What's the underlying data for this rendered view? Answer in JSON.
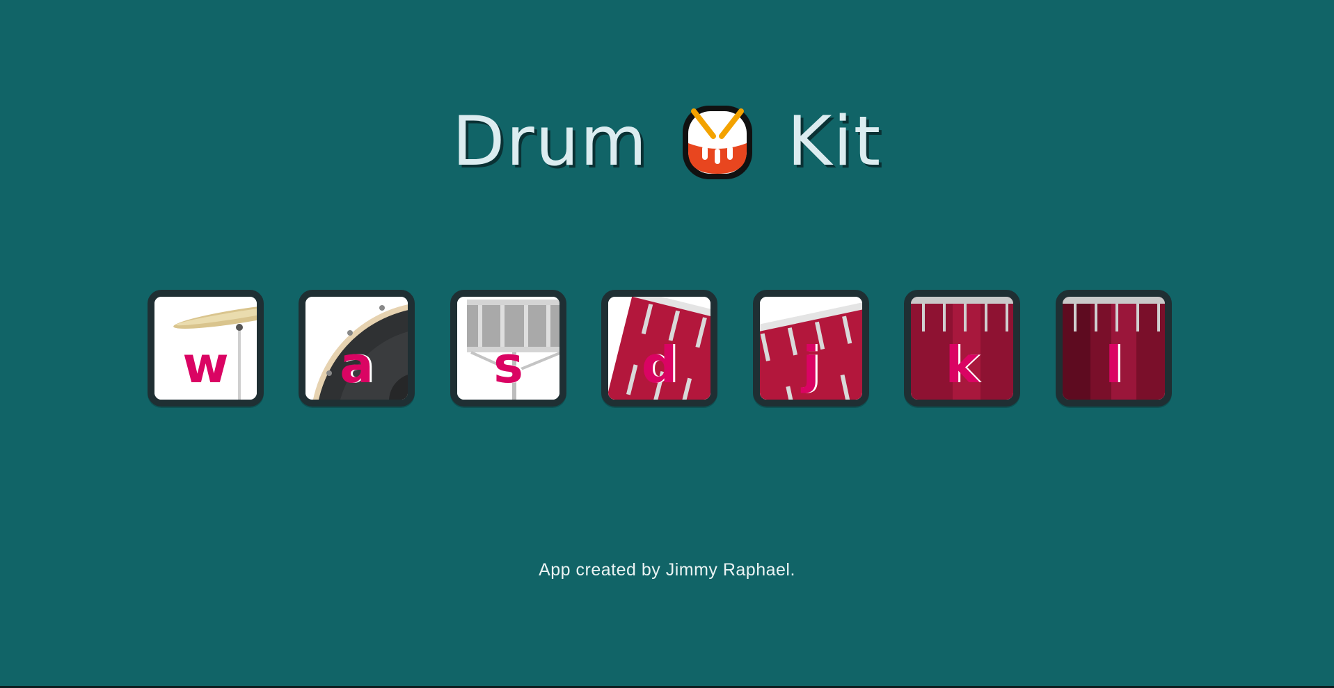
{
  "header": {
    "title_left": "Drum",
    "title_right": "Kit",
    "emoji_icon": "drum-emoji-icon"
  },
  "pads": [
    {
      "key": "w",
      "drum": "crash-cymbal"
    },
    {
      "key": "a",
      "drum": "kick-bass"
    },
    {
      "key": "s",
      "drum": "snare"
    },
    {
      "key": "d",
      "drum": "tom-1"
    },
    {
      "key": "j",
      "drum": "tom-2"
    },
    {
      "key": "k",
      "drum": "tom-3"
    },
    {
      "key": "l",
      "drum": "tom-4"
    }
  ],
  "footer": {
    "text": "App created by Jimmy Raphael."
  },
  "colors": {
    "background": "#116467",
    "title": "#dcecf0",
    "key_letter": "#da0463",
    "pad_border": "#1f2f33"
  }
}
